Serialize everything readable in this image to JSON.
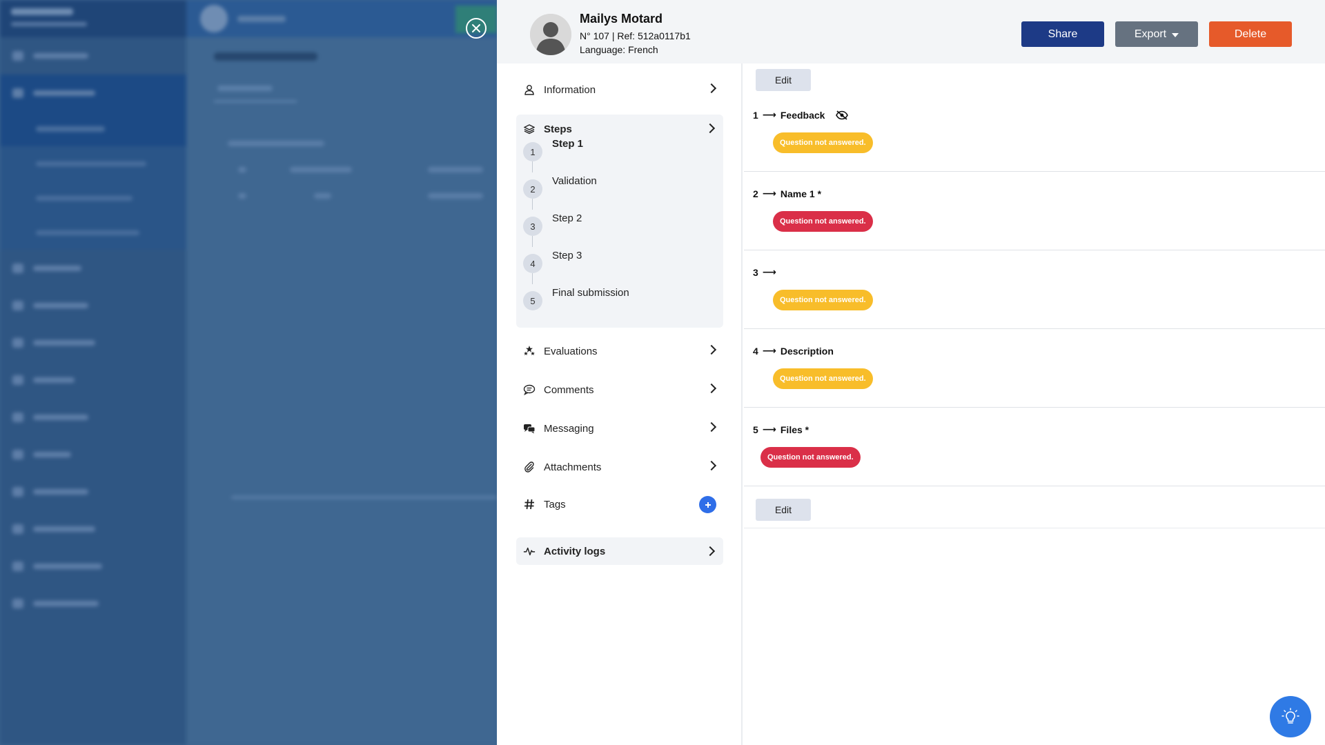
{
  "applicant": {
    "name": "Mailys Motard",
    "ref_line": "N° 107 | Ref: 512a0117b1",
    "language_line": "Language: French"
  },
  "header_buttons": {
    "share": "Share",
    "export": "Export",
    "delete": "Delete"
  },
  "menu": {
    "information": "Information",
    "steps": "Steps",
    "evaluations": "Evaluations",
    "comments": "Comments",
    "messaging": "Messaging",
    "attachments": "Attachments",
    "tags": "Tags",
    "activity_logs": "Activity logs"
  },
  "steps": [
    {
      "num": "1",
      "label": "Step 1"
    },
    {
      "num": "2",
      "label": "Validation"
    },
    {
      "num": "3",
      "label": "Step 2"
    },
    {
      "num": "4",
      "label": "Step 3"
    },
    {
      "num": "5",
      "label": "Final submission"
    }
  ],
  "content": {
    "edit_label": "Edit",
    "arrow": "⟶",
    "questions": [
      {
        "num": "1",
        "title": "Feedback",
        "status": "Question not answered.",
        "status_color": "#f8bd2a"
      },
      {
        "num": "2",
        "title": "Name 1 *",
        "status": "Question not answered.",
        "status_color": "#da2f48"
      },
      {
        "num": "3",
        "title": "",
        "status": "Question not answered.",
        "status_color": "#f8bd2a"
      },
      {
        "num": "4",
        "title": "Description",
        "status": "Question not answered.",
        "status_color": "#f8bd2a"
      },
      {
        "num": "5",
        "title": "Files *",
        "status": "Question not answered.",
        "status_color": "#da2f48"
      }
    ]
  },
  "icons": {
    "close": "close-circle-icon",
    "hidden": "eye-slash-icon",
    "help": "lightbulb-icon"
  },
  "colors": {
    "share": "#1d3a86",
    "export": "#667280",
    "delete": "#e65a2a",
    "accent": "#2f7ae5"
  }
}
